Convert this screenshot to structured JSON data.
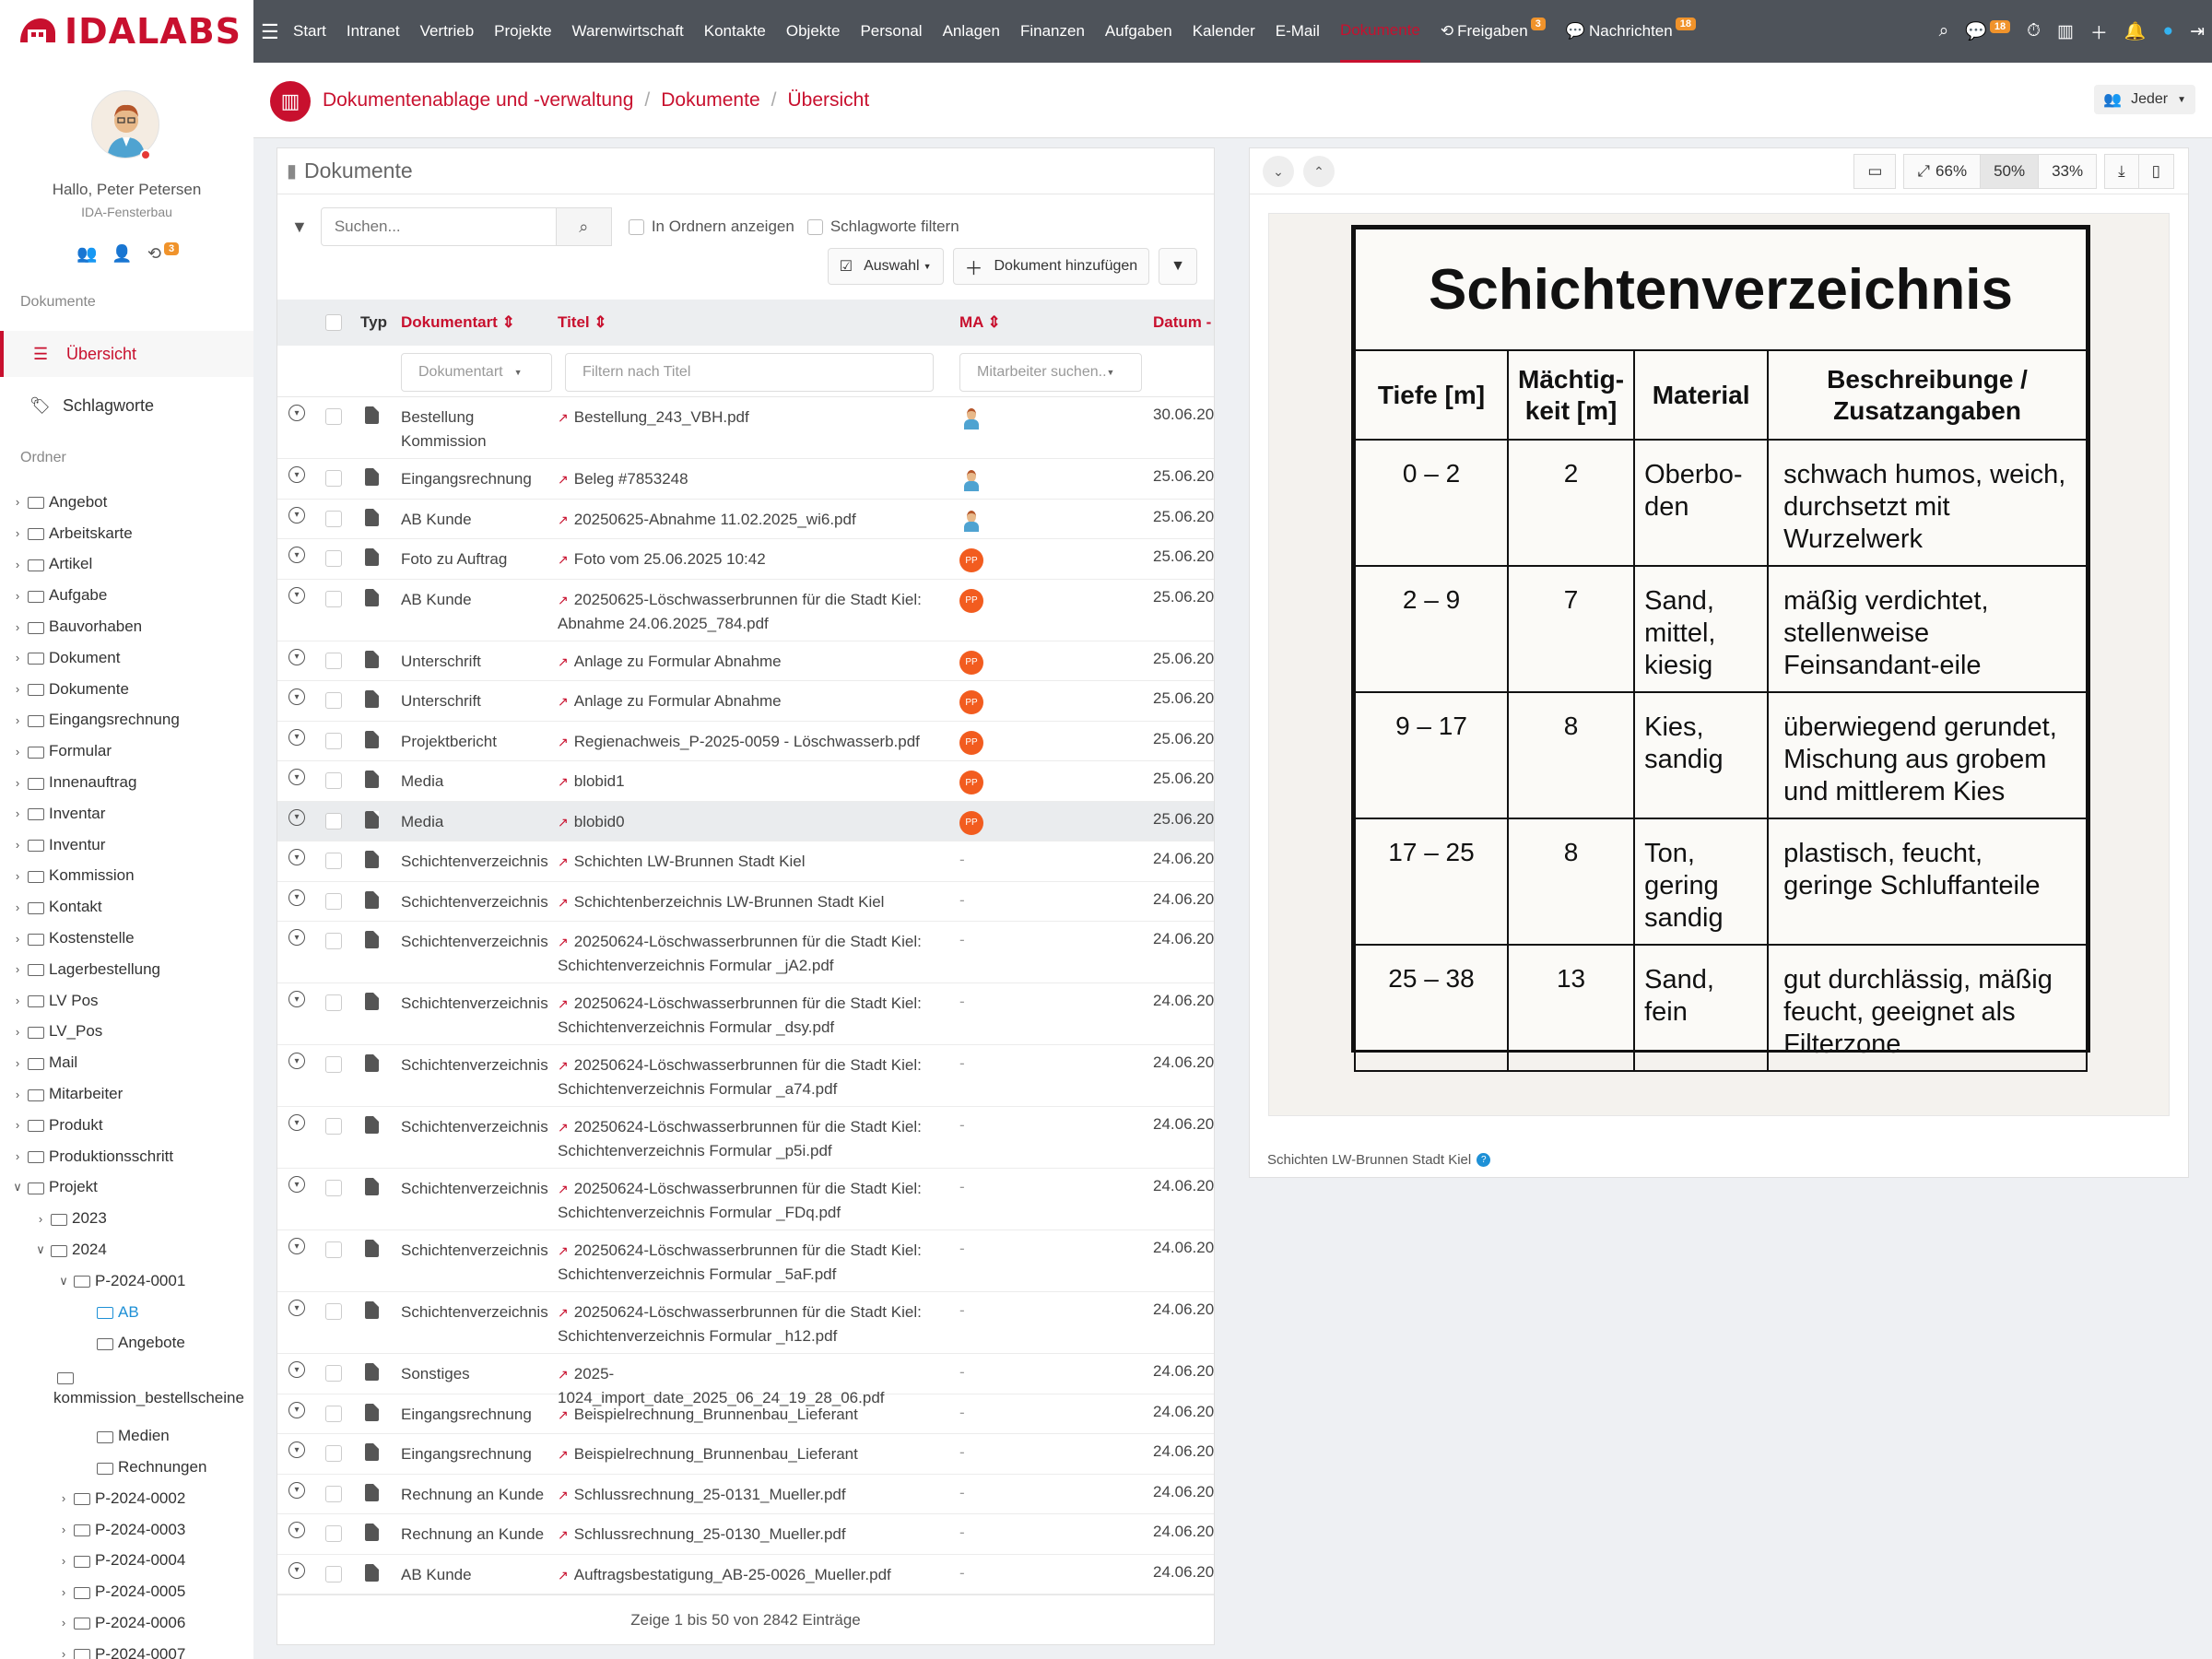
{
  "app": {
    "logo_text": "IDALABS"
  },
  "topnav": {
    "items": [
      "Start",
      "Intranet",
      "Vertrieb",
      "Projekte",
      "Warenwirtschaft",
      "Kontakte",
      "Objekte",
      "Personal",
      "Anlagen",
      "Finanzen",
      "Aufgaben",
      "Kalender",
      "E-Mail",
      "Dokumente"
    ],
    "active": "Dokumente",
    "freigaben_label": "Freigaben",
    "freigaben_badge": "3",
    "nachrichten_label": "Nachrichten",
    "nachrichten_badge": "18",
    "chat_badge": "18",
    "accent": "#c8102e"
  },
  "sidebar": {
    "greeting": "Hallo, Peter Petersen",
    "company": "IDA-Fensterbau",
    "user_badge": "3",
    "section_documents": "Dokumente",
    "nav_overview": "Übersicht",
    "nav_tags": "Schlagworte",
    "section_folders": "Ordner",
    "folders": [
      {
        "label": "Angebot",
        "level": 0,
        "open": false
      },
      {
        "label": "Arbeitskarte",
        "level": 0,
        "open": false
      },
      {
        "label": "Artikel",
        "level": 0,
        "open": false
      },
      {
        "label": "Aufgabe",
        "level": 0,
        "open": false
      },
      {
        "label": "Bauvorhaben",
        "level": 0,
        "open": false
      },
      {
        "label": "Dokument",
        "level": 0,
        "open": false
      },
      {
        "label": "Dokumente",
        "level": 0,
        "open": false
      },
      {
        "label": "Eingangsrechnung",
        "level": 0,
        "open": false
      },
      {
        "label": "Formular",
        "level": 0,
        "open": false
      },
      {
        "label": "Innenauftrag",
        "level": 0,
        "open": false
      },
      {
        "label": "Inventar",
        "level": 0,
        "open": false
      },
      {
        "label": "Inventur",
        "level": 0,
        "open": false
      },
      {
        "label": "Kommission",
        "level": 0,
        "open": false
      },
      {
        "label": "Kontakt",
        "level": 0,
        "open": false
      },
      {
        "label": "Kostenstelle",
        "level": 0,
        "open": false
      },
      {
        "label": "Lagerbestellung",
        "level": 0,
        "open": false
      },
      {
        "label": "LV Pos",
        "level": 0,
        "open": false
      },
      {
        "label": "LV_Pos",
        "level": 0,
        "open": false
      },
      {
        "label": "Mail",
        "level": 0,
        "open": false
      },
      {
        "label": "Mitarbeiter",
        "level": 0,
        "open": false
      },
      {
        "label": "Produkt",
        "level": 0,
        "open": false
      },
      {
        "label": "Produktionsschritt",
        "level": 0,
        "open": false
      },
      {
        "label": "Projekt",
        "level": 0,
        "open": true
      },
      {
        "label": "2023",
        "level": 1,
        "open": false
      },
      {
        "label": "2024",
        "level": 1,
        "open": true
      },
      {
        "label": "P-2024-0001",
        "level": 2,
        "open": true
      },
      {
        "label": "AB",
        "level": 3,
        "leaf": true,
        "selected": true
      },
      {
        "label": "Angebote",
        "level": 3,
        "leaf": true
      },
      {
        "label": "kommission_bestellscheine",
        "level": 3,
        "leaf": true,
        "wrap": true
      },
      {
        "label": "Medien",
        "level": 3,
        "leaf": true
      },
      {
        "label": "Rechnungen",
        "level": 3,
        "leaf": true
      },
      {
        "label": "P-2024-0002",
        "level": 2,
        "open": false
      },
      {
        "label": "P-2024-0003",
        "level": 2,
        "open": false
      },
      {
        "label": "P-2024-0004",
        "level": 2,
        "open": false
      },
      {
        "label": "P-2024-0005",
        "level": 2,
        "open": false
      },
      {
        "label": "P-2024-0006",
        "level": 2,
        "open": false
      },
      {
        "label": "P-2024-0007",
        "level": 2,
        "open": false
      }
    ]
  },
  "breadcrumb": [
    "Dokumentenablage und -verwaltung",
    "Dokumente",
    "Übersicht"
  ],
  "header_right": {
    "label": "Jeder"
  },
  "list": {
    "title": "Dokumente",
    "search_placeholder": "Suchen...",
    "opt_folders": "In Ordnern anzeigen",
    "opt_tags": "Schlagworte filtern",
    "btn_select": "Auswahl",
    "btn_add": "Dokument hinzufügen",
    "columns": {
      "typ": "Typ",
      "art": "Dokumentart",
      "titel": "Titel",
      "ma": "MA",
      "datum": "Datum"
    },
    "filter_art": "Dokumentart",
    "filter_title_placeholder": "Filtern nach Titel",
    "filter_ma": "Mitarbeiter suchen..",
    "rows": [
      {
        "art": "Bestellung Kommission",
        "titel": "Bestellung_243_VBH.pdf",
        "ma": "avatar",
        "datum": "30.06.20"
      },
      {
        "art": "Eingangsrechnung",
        "titel": "Beleg #7853248",
        "ma": "avatar",
        "datum": "25.06.20"
      },
      {
        "art": "AB Kunde",
        "titel": "20250625-Abnahme 11.02.2025_wi6.pdf",
        "ma": "avatar",
        "datum": "25.06.20"
      },
      {
        "art": "Foto zu Auftrag",
        "titel": "Foto vom 25.06.2025 10:42",
        "ma": "PP",
        "datum": "25.06.20"
      },
      {
        "art": "AB Kunde",
        "titel": "20250625-Löschwasserbrunnen für die Stadt Kiel: Abnahme 24.06.2025_784.pdf",
        "ma": "PP",
        "datum": "25.06.20"
      },
      {
        "art": "Unterschrift",
        "titel": "Anlage zu Formular Abnahme",
        "ma": "PP",
        "datum": "25.06.20"
      },
      {
        "art": "Unterschrift",
        "titel": "Anlage zu Formular Abnahme",
        "ma": "PP",
        "datum": "25.06.20"
      },
      {
        "art": "Projektbericht",
        "titel": "Regienachweis_P-2025-0059 - Löschwasserb.pdf",
        "ma": "PP",
        "datum": "25.06.20"
      },
      {
        "art": "Media",
        "titel": "blobid1",
        "ma": "PP",
        "datum": "25.06.20"
      },
      {
        "art": "Media",
        "titel": "blobid0",
        "ma": "PP",
        "datum": "25.06.20",
        "highlight": true
      },
      {
        "art": "Schichtenverzeichnis",
        "titel": "Schichten LW-Brunnen Stadt Kiel",
        "ma": "-",
        "datum": "24.06.20"
      },
      {
        "art": "Schichtenverzeichnis",
        "titel": "Schichtenberzeichnis LW-Brunnen Stadt Kiel",
        "ma": "-",
        "datum": "24.06.20"
      },
      {
        "art": "Schichtenverzeichnis",
        "titel": "20250624-Löschwasserbrunnen für die Stadt Kiel: Schichtenverzeichnis Formular _jA2.pdf",
        "ma": "-",
        "datum": "24.06.20"
      },
      {
        "art": "Schichtenverzeichnis",
        "titel": "20250624-Löschwasserbrunnen für die Stadt Kiel: Schichtenverzeichnis Formular _dsy.pdf",
        "ma": "-",
        "datum": "24.06.20"
      },
      {
        "art": "Schichtenverzeichnis",
        "titel": "20250624-Löschwasserbrunnen für die Stadt Kiel: Schichtenverzeichnis Formular _a74.pdf",
        "ma": "-",
        "datum": "24.06.20"
      },
      {
        "art": "Schichtenverzeichnis",
        "titel": "20250624-Löschwasserbrunnen für die Stadt Kiel: Schichtenverzeichnis Formular _p5i.pdf",
        "ma": "-",
        "datum": "24.06.20"
      },
      {
        "art": "Schichtenverzeichnis",
        "titel": "20250624-Löschwasserbrunnen für die Stadt Kiel: Schichtenverzeichnis Formular _FDq.pdf",
        "ma": "-",
        "datum": "24.06.20"
      },
      {
        "art": "Schichtenverzeichnis",
        "titel": "20250624-Löschwasserbrunnen für die Stadt Kiel: Schichtenverzeichnis Formular _5aF.pdf",
        "ma": "-",
        "datum": "24.06.20"
      },
      {
        "art": "Schichtenverzeichnis",
        "titel": "20250624-Löschwasserbrunnen für die Stadt Kiel: Schichtenverzeichnis Formular _h12.pdf",
        "ma": "-",
        "datum": "24.06.20"
      },
      {
        "art": "Sonstiges",
        "titel": "2025-1024_import_date_2025_06_24_19_28_06.pdf",
        "ma": "-",
        "datum": "24.06.20"
      },
      {
        "art": "Eingangsrechnung",
        "titel": "Beispielrechnung_Brunnenbau_Lieferant",
        "ma": "-",
        "datum": "24.06.20"
      },
      {
        "art": "Eingangsrechnung",
        "titel": "Beispielrechnung_Brunnenbau_Lieferant",
        "ma": "-",
        "datum": "24.06.20"
      },
      {
        "art": "Rechnung an Kunde",
        "titel": "Schlussrechnung_25-0131_Mueller.pdf",
        "ma": "-",
        "datum": "24.06.20"
      },
      {
        "art": "Rechnung an Kunde",
        "titel": "Schlussrechnung_25-0130_Mueller.pdf",
        "ma": "-",
        "datum": "24.06.20"
      },
      {
        "art": "AB Kunde",
        "titel": "Auftragsbestatigung_AB-25-0026_Mueller.pdf",
        "ma": "-",
        "datum": "24.06.20"
      }
    ],
    "footer": "Zeige 1 bis 50 von 2842 Einträge"
  },
  "preview": {
    "zoom_66": "66%",
    "zoom_50": "50%",
    "zoom_33": "33%",
    "zoom_active": "50%",
    "caption": "Schichten LW-Brunnen Stadt Kiel",
    "document": {
      "title": "Schichtenverzeichnis",
      "headers": [
        "Tiefe [m]",
        "Mächtig-keit [m]",
        "Material",
        "Beschreibunge / Zusatzangaben"
      ],
      "rows": [
        {
          "tiefe": "0 – 2",
          "maechtigkeit": "2",
          "material": "Oberbo-den",
          "beschreibung": "schwach humos, weich, durchsetzt mit Wurzelwerk"
        },
        {
          "tiefe": "2 – 9",
          "maechtigkeit": "7",
          "material": "Sand, mittel, kiesig",
          "beschreibung": "mäßig verdichtet, stellenweise Feinsandant-eile"
        },
        {
          "tiefe": "9 – 17",
          "maechtigkeit": "8",
          "material": "Kies, sandig",
          "beschreibung": "überwiegend gerundet, Mischung aus grobem und mittlerem Kies"
        },
        {
          "tiefe": "17 – 25",
          "maechtigkeit": "8",
          "material": "Ton, gering sandig",
          "beschreibung": "plastisch, feucht, geringe Schluffanteile"
        },
        {
          "tiefe": "25 – 38",
          "maechtigkeit": "13",
          "material": "Sand, fein",
          "beschreibung": "gut durchlässig, mäßig feucht, geeignet als Filterzone"
        }
      ]
    }
  }
}
